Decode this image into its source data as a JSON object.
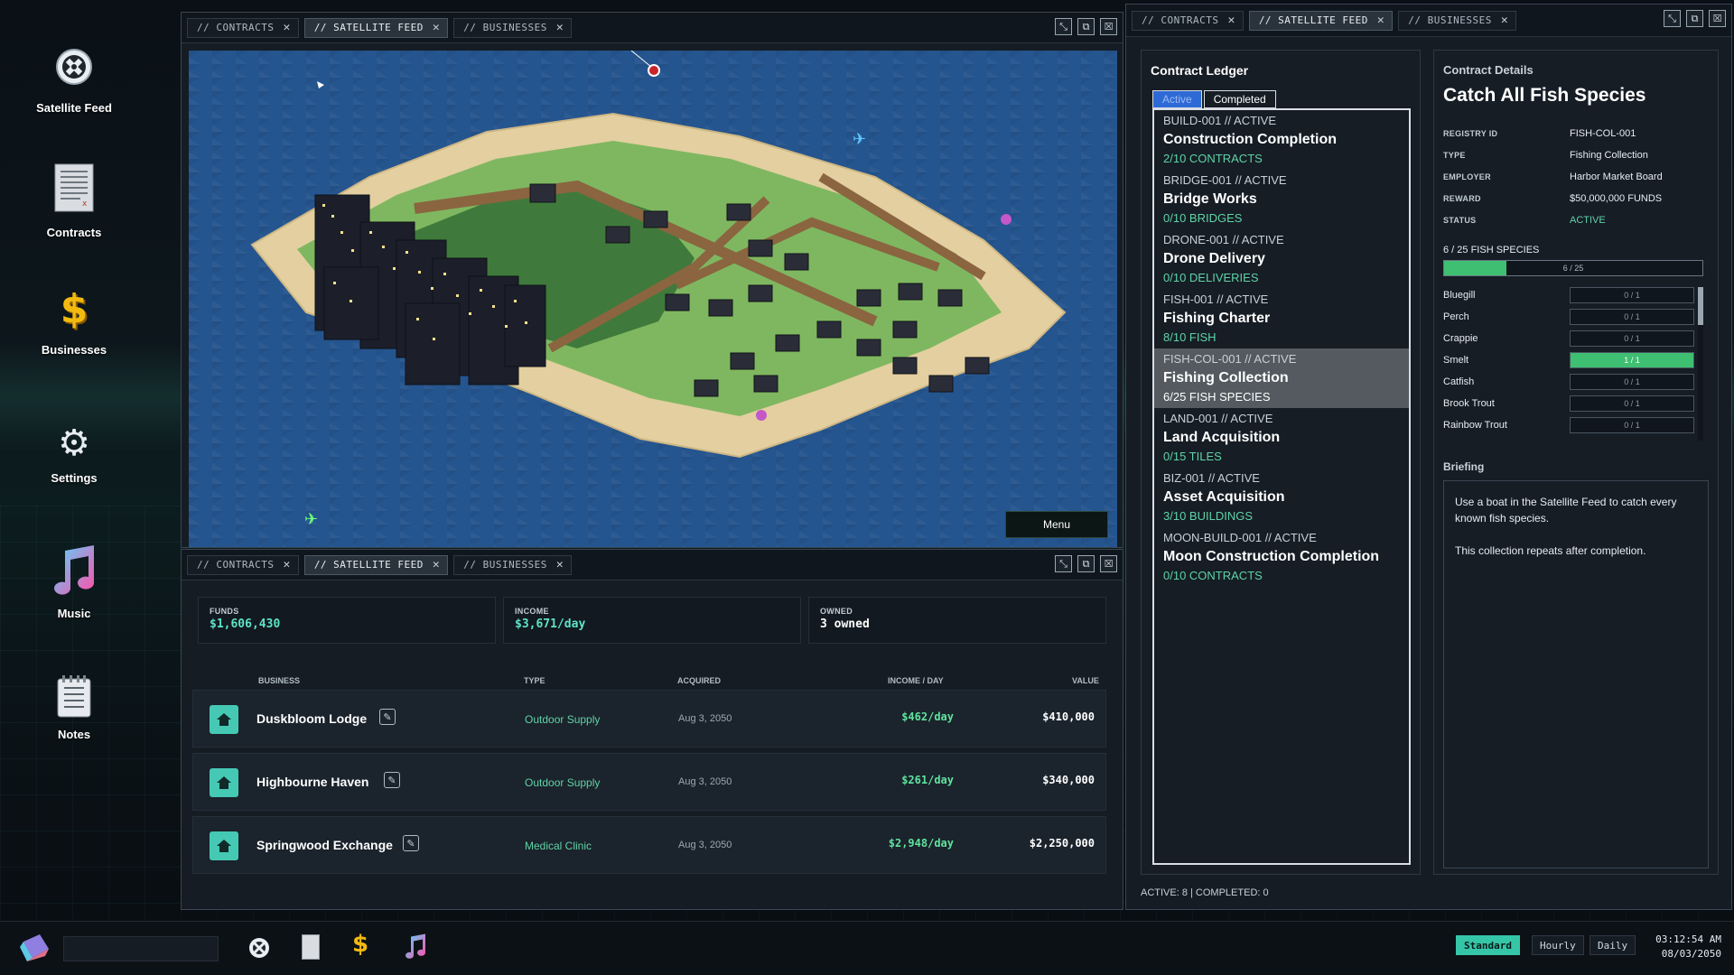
{
  "desktop": {
    "icons": [
      {
        "label": "Satellite Feed",
        "icon": "satellite-icon"
      },
      {
        "label": "Contracts",
        "icon": "document-icon"
      },
      {
        "label": "Businesses",
        "icon": "dollar-icon"
      },
      {
        "label": "Settings",
        "icon": "gear-icon"
      },
      {
        "label": "Music",
        "icon": "music-note-icon"
      },
      {
        "label": "Notes",
        "icon": "notepad-icon"
      }
    ]
  },
  "tabs": {
    "contracts": "// CONTRACTS",
    "satellite": "// SATELLITE FEED",
    "businesses": "// BUSINESSES",
    "close": "✕"
  },
  "satellite": {
    "menu_label": "Menu"
  },
  "businesses": {
    "stats": [
      {
        "key": "FUNDS",
        "value": "$1,606,430"
      },
      {
        "key": "INCOME",
        "value": "$3,671/day"
      },
      {
        "key": "OWNED",
        "value": "3 owned"
      }
    ],
    "columns": [
      "BUSINESS",
      "TYPE",
      "ACQUIRED",
      "INCOME / DAY",
      "VALUE"
    ],
    "rows": [
      {
        "name": "Duskbloom Lodge",
        "type": "Outdoor Supply",
        "acquired": "Aug 3, 2050",
        "income": "$462/day",
        "value": "$410,000"
      },
      {
        "name": "Highbourne Haven",
        "type": "Outdoor Supply",
        "acquired": "Aug 3, 2050",
        "income": "$261/day",
        "value": "$340,000"
      },
      {
        "name": "Springwood Exchange",
        "type": "Medical Clinic",
        "acquired": "Aug 3, 2050",
        "income": "$2,948/day",
        "value": "$2,250,000"
      }
    ]
  },
  "contracts": {
    "ledger_title": "Contract Ledger",
    "filter_active": "Active",
    "filter_completed": "Completed",
    "items": [
      {
        "id": "BUILD-001 // ACTIVE",
        "title": "Construction Completion",
        "progress": "2/10 CONTRACTS"
      },
      {
        "id": "BRIDGE-001 // ACTIVE",
        "title": "Bridge Works",
        "progress": "0/10 BRIDGES"
      },
      {
        "id": "DRONE-001 // ACTIVE",
        "title": "Drone Delivery",
        "progress": "0/10 DELIVERIES"
      },
      {
        "id": "FISH-001 // ACTIVE",
        "title": "Fishing Charter",
        "progress": "8/10 FISH"
      },
      {
        "id": "FISH-COL-001 // ACTIVE",
        "title": "Fishing Collection",
        "progress": "6/25 FISH SPECIES",
        "selected": true
      },
      {
        "id": "LAND-001 // ACTIVE",
        "title": "Land Acquisition",
        "progress": "0/15 TILES"
      },
      {
        "id": "BIZ-001 // ACTIVE",
        "title": "Asset Acquisition",
        "progress": "3/10 BUILDINGS"
      },
      {
        "id": "MOON-BUILD-001 // ACTIVE",
        "title": "Moon Construction Completion",
        "progress": "0/10 CONTRACTS"
      }
    ],
    "footer": "ACTIVE: 8 | COMPLETED: 0",
    "details": {
      "section_title": "Contract Details",
      "title": "Catch All Fish Species",
      "fields": [
        {
          "key": "REGISTRY ID",
          "value": "FISH-COL-001"
        },
        {
          "key": "TYPE",
          "value": "Fishing Collection"
        },
        {
          "key": "EMPLOYER",
          "value": "Harbor Market Board"
        },
        {
          "key": "REWARD",
          "value": "$50,000,000 FUNDS"
        },
        {
          "key": "STATUS",
          "value": "ACTIVE"
        }
      ],
      "progress_label": "6 / 25 FISH SPECIES",
      "progress_text": "6 / 25",
      "progress_fraction": 0.24,
      "fish": [
        {
          "name": "Bluegill",
          "text": "0 / 1",
          "fraction": 0
        },
        {
          "name": "Perch",
          "text": "0 / 1",
          "fraction": 0
        },
        {
          "name": "Crappie",
          "text": "0 / 1",
          "fraction": 0
        },
        {
          "name": "Smelt",
          "text": "1 / 1",
          "fraction": 1
        },
        {
          "name": "Catfish",
          "text": "0 / 1",
          "fraction": 0
        },
        {
          "name": "Brook Trout",
          "text": "0 / 1",
          "fraction": 0
        },
        {
          "name": "Rainbow Trout",
          "text": "0 / 1",
          "fraction": 0
        }
      ],
      "briefing_title": "Briefing",
      "briefing_line1": "Use a boat in the Satellite Feed to catch every known fish species.",
      "briefing_line2": "This collection repeats after completion."
    }
  },
  "taskbar": {
    "modes": [
      "Standard",
      "Hourly",
      "Daily"
    ],
    "active_mode": "Standard",
    "time": "03:12:54 AM",
    "date": "08/03/2050"
  },
  "colors": {
    "accent": "#35c6a8",
    "progress_green": "#3fbf72",
    "ocean": "#25558e",
    "sand": "#e3cfa0",
    "grass": "#7fb760"
  }
}
